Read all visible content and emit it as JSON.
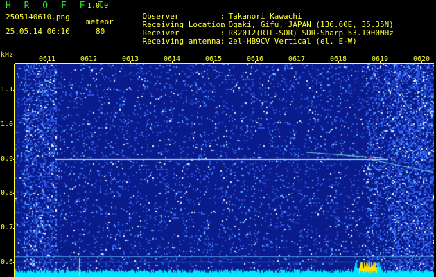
{
  "app": {
    "title": "H R O F F T",
    "version": "1.0.0"
  },
  "file": {
    "name": "2505140610.png",
    "datetime": "25.05.14 06:10"
  },
  "meteor": {
    "label": "meteor",
    "count": "80"
  },
  "info": [
    {
      "key": "Observer",
      "value": "Takanori Kawachi"
    },
    {
      "key": "Receiving Location",
      "value": "Ogaki, Gifu, JAPAN (136.60E, 35.35N)"
    },
    {
      "key": "Receiver",
      "value": "R820T2(RTL-SDR) SDR-Sharp 53.1000MHz"
    },
    {
      "key": "Receiving antenna",
      "value": "2el-HB9CV Vertical (el. E-W)"
    }
  ],
  "axis": {
    "y_unit": "kHz",
    "y_ticks": [
      "1.1",
      "1.0",
      "0.9",
      "0.8",
      "0.7",
      "0.6"
    ],
    "x_ticks": [
      "0611",
      "0612",
      "0613",
      "0614",
      "0615",
      "0616",
      "0617",
      "0618",
      "0619",
      "0620"
    ]
  },
  "colors": {
    "label": "#ffff33",
    "title": "#2fe02f",
    "background": "#0a1c8c",
    "carrier": "#7fd8ff"
  }
}
